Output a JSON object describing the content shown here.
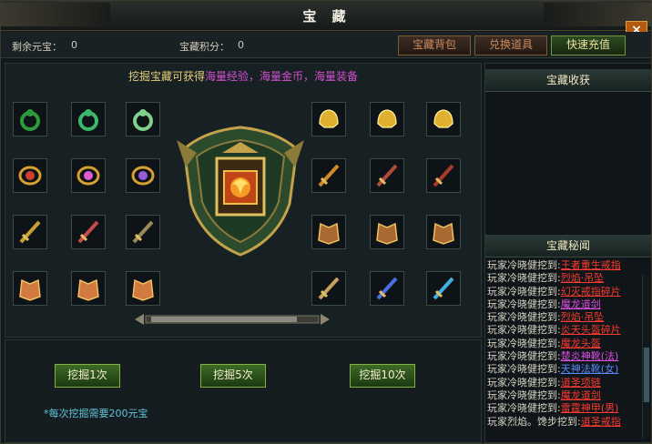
{
  "window": {
    "title": "宝 藏",
    "close_label": "×"
  },
  "infobar": {
    "remaining_label": "剩余元宝：",
    "remaining_value": "0",
    "points_label": "宝藏积分：",
    "points_value": "0",
    "buttons": [
      "宝藏背包",
      "兑换道具",
      "快速充值"
    ]
  },
  "banner": {
    "prefix": "挖掘宝藏可获得",
    "highlights": "海量经验，海量金币，海量装备"
  },
  "dig_buttons": [
    "挖掘1次",
    "挖掘5次",
    "挖掘10次"
  ],
  "note": "*每次挖掘需要200元宝",
  "right": {
    "harvest_title": "宝藏收获",
    "news_title": "宝藏秘闻",
    "logs": [
      {
        "who": "玩家冷晓健挖到:",
        "item": "王者重生戒指",
        "color": "red"
      },
      {
        "who": "玩家冷晓健挖到:",
        "item": "烈焰·吊坠",
        "color": "red"
      },
      {
        "who": "玩家冷晓健挖到:",
        "item": "幻灭戒指碎片",
        "color": "red"
      },
      {
        "who": "玩家冷晓健挖到:",
        "item": "魔龙道剑",
        "color": "purple"
      },
      {
        "who": "玩家冷晓健挖到:",
        "item": "烈焰·吊坠",
        "color": "red"
      },
      {
        "who": "玩家冷晓健挖到:",
        "item": "炎天头盔碎片",
        "color": "red"
      },
      {
        "who": "玩家冷晓健挖到:",
        "item": "魔龙头盔",
        "color": "red"
      },
      {
        "who": "玩家冷晓健挖到:",
        "item": "楚炎神靴(法)",
        "color": "purple"
      },
      {
        "who": "玩家冷晓健挖到:",
        "item": "天神法靴(女)",
        "color": "blue"
      },
      {
        "who": "玩家冷晓健挖到:",
        "item": "道圣项链",
        "color": "red"
      },
      {
        "who": "玩家冷晓健挖到:",
        "item": "魔龙道剑",
        "color": "red"
      },
      {
        "who": "玩家冷晓健挖到:",
        "item": "雷霆神甲(男)",
        "color": "red"
      },
      {
        "who": "玩家烈焰。馋步挖到:",
        "item": "道圣戒指",
        "color": "red"
      }
    ]
  },
  "slots": [
    "green-ring-icon",
    "jade-ring-icon",
    "silver-ring-icon",
    "ruby-bracelet-icon",
    "pink-bracelet-icon",
    "purple-bracelet-icon",
    "dark-sword-icon",
    "magic-staff-icon",
    "bone-sword-icon",
    "winged-armor-icon",
    "winged-armor-icon",
    "winged-armor-icon",
    "gold-helmet-icon",
    "gold-helmet-icon",
    "gold-helmet-icon",
    "flame-blade-icon",
    "spear-icon",
    "crimson-sword-icon",
    "bronze-armor-icon",
    "bronze-armor-icon",
    "bronze-armor-icon",
    "scythe-icon",
    "blue-staff-icon",
    "azure-sword-icon"
  ],
  "colors": {
    "accent_gold": "#e6cf7a",
    "highlight_purple": "#d44fd0",
    "item_red": "#ff3b30"
  }
}
